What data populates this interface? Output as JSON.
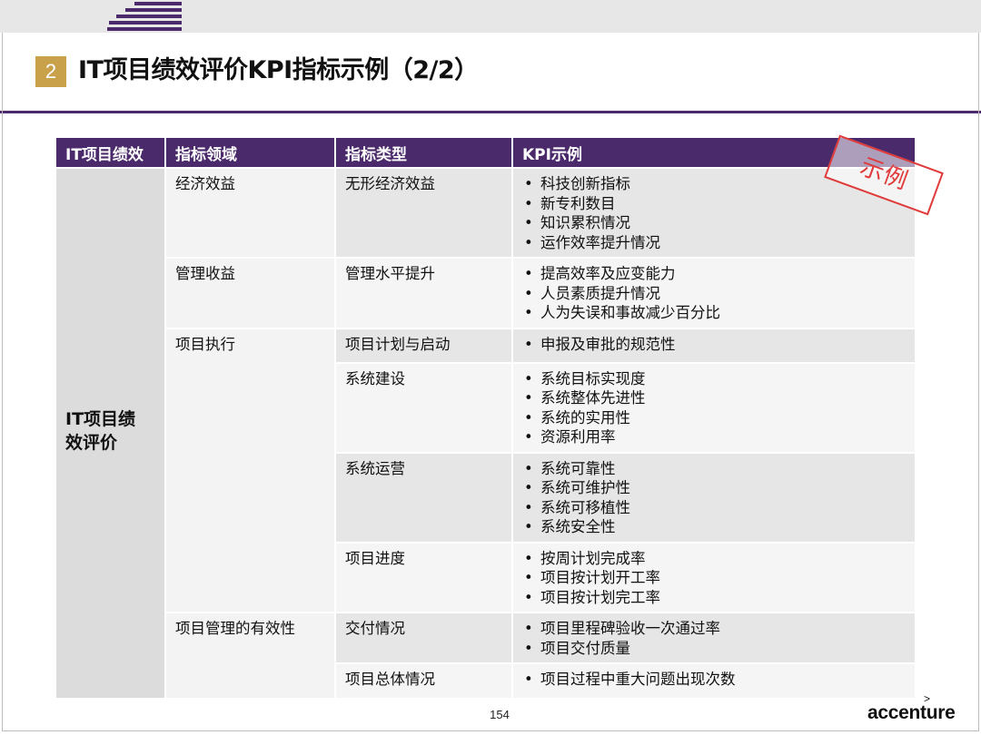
{
  "header": {
    "section_number": "2",
    "title": "IT项目绩效评价KPI指标示例（2/2）"
  },
  "table": {
    "columns": [
      "IT项目绩效",
      "指标领域",
      "指标类型",
      "KPI示例"
    ],
    "category": "IT项目绩效评价",
    "rows": [
      {
        "domain": "经济效益",
        "type": "无形经济效益",
        "kpis": [
          "科技创新指标",
          "新专利数目",
          "知识累积情况",
          "运作效率提升情况"
        ]
      },
      {
        "domain": "管理收益",
        "type": "管理水平提升",
        "kpis": [
          "提高效率及应变能力",
          "人员素质提升情况",
          "人为失误和事故减少百分比"
        ]
      },
      {
        "domain": "项目执行",
        "type": "项目计划与启动",
        "kpis": [
          "申报及审批的规范性"
        ]
      },
      {
        "domain": "",
        "type": "系统建设",
        "kpis": [
          "系统目标实现度",
          "系统整体先进性",
          "系统的实用性",
          "资源利用率"
        ]
      },
      {
        "domain": "",
        "type": "系统运营",
        "kpis": [
          "系统可靠性",
          "系统可维护性",
          "系统可移植性",
          "系统安全性"
        ]
      },
      {
        "domain": "",
        "type": "项目进度",
        "kpis": [
          "按周计划完成率",
          "项目按计划开工率",
          "项目按计划完工率"
        ]
      },
      {
        "domain": "项目管理的有效性",
        "type": "交付情况",
        "kpis": [
          "项目里程碑验收一次通过率",
          "项目交付质量"
        ]
      },
      {
        "domain": "",
        "type": "项目总体情况",
        "kpis": [
          "项目过程中重大问题出现次数"
        ]
      }
    ]
  },
  "stamp": {
    "label": "示例"
  },
  "footer": {
    "page_number": "154",
    "brand": "accenture",
    "brand_mark": ">"
  },
  "colors": {
    "accent": "#4b2a6b",
    "badge": "#c9a14a",
    "stamp": "#e03a3a"
  }
}
